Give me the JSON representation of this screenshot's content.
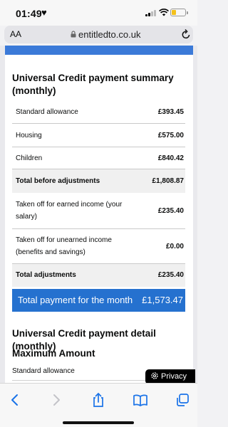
{
  "status_bar": {
    "time": "01:49",
    "heart": "♥"
  },
  "address_bar": {
    "text_size_label": "AA",
    "domain": "entitledto.co.uk"
  },
  "summary": {
    "title": "Universal Credit payment summary (monthly)",
    "rows": [
      {
        "label": "Standard allowance",
        "value": "£393.45"
      },
      {
        "label": "Housing",
        "value": "£575.00"
      },
      {
        "label": "Children",
        "value": "£840.42"
      },
      {
        "label": "Total before adjustments",
        "value": "£1,808.87"
      },
      {
        "label": "Taken off for earned income (your salary)",
        "value": "£235.40"
      },
      {
        "label": "Taken off for unearned income (benefits and savings)",
        "value": "£0.00"
      },
      {
        "label": "Total adjustments",
        "value": "£235.40"
      }
    ],
    "total": {
      "label": "Total payment for the month",
      "value": "£1,573.47"
    }
  },
  "detail": {
    "title": "Universal Credit payment detail (monthly)",
    "section_title": "Maximum Amount",
    "first_row_label": "Standard allowance"
  },
  "privacy_button": {
    "label": "Privacy"
  },
  "toolbar": {
    "icons": [
      "back-icon",
      "forward-icon",
      "share-icon",
      "bookmarks-icon",
      "tabs-icon"
    ]
  },
  "colors": {
    "accent_blue": "#2571cf",
    "battery": "#f4c11b"
  }
}
